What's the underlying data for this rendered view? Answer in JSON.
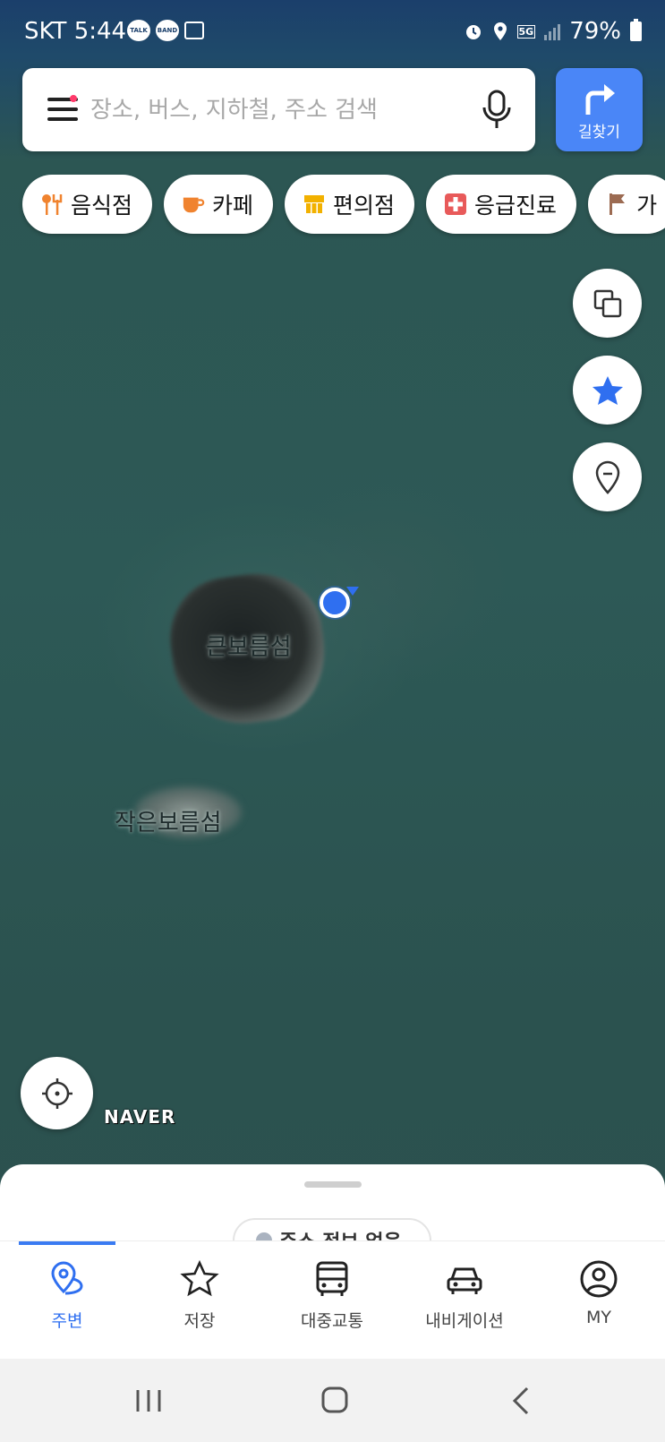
{
  "status_bar": {
    "carrier": "SKT",
    "time": "5:44",
    "notif_talk": "TALK",
    "notif_band": "BAND",
    "network": "5G",
    "battery": "79%"
  },
  "search": {
    "placeholder": "장소, 버스, 지하철, 주소 검색",
    "route_label": "길찾기"
  },
  "categories": [
    {
      "label": "음식점",
      "icon": "fork-spoon-icon",
      "color": "#f0832f"
    },
    {
      "label": "카페",
      "icon": "coffee-cup-icon",
      "color": "#f0832f"
    },
    {
      "label": "편의점",
      "icon": "store-icon",
      "color": "#f2b100"
    },
    {
      "label": "응급진료",
      "icon": "medical-cross-icon",
      "color": "#e85a5a"
    },
    {
      "label": "가",
      "icon": "flag-icon",
      "color": "#9c6b52"
    }
  ],
  "map": {
    "labels": {
      "big_island": "큰보름섬",
      "small_island": "작은보름섬"
    },
    "provider": "NAVER"
  },
  "sheet": {
    "address_status": "주소 정보 없음"
  },
  "tabs": [
    {
      "label": "주변",
      "icon": "nearby-pin-icon",
      "active": true
    },
    {
      "label": "저장",
      "icon": "star-icon",
      "active": false
    },
    {
      "label": "대중교통",
      "icon": "bus-icon",
      "active": false
    },
    {
      "label": "내비게이션",
      "icon": "car-icon",
      "active": false
    },
    {
      "label": "MY",
      "icon": "user-icon",
      "active": false
    }
  ],
  "colors": {
    "accent": "#2f6ff0",
    "route_button": "#4a86f7",
    "map_water": "#2c5552"
  }
}
